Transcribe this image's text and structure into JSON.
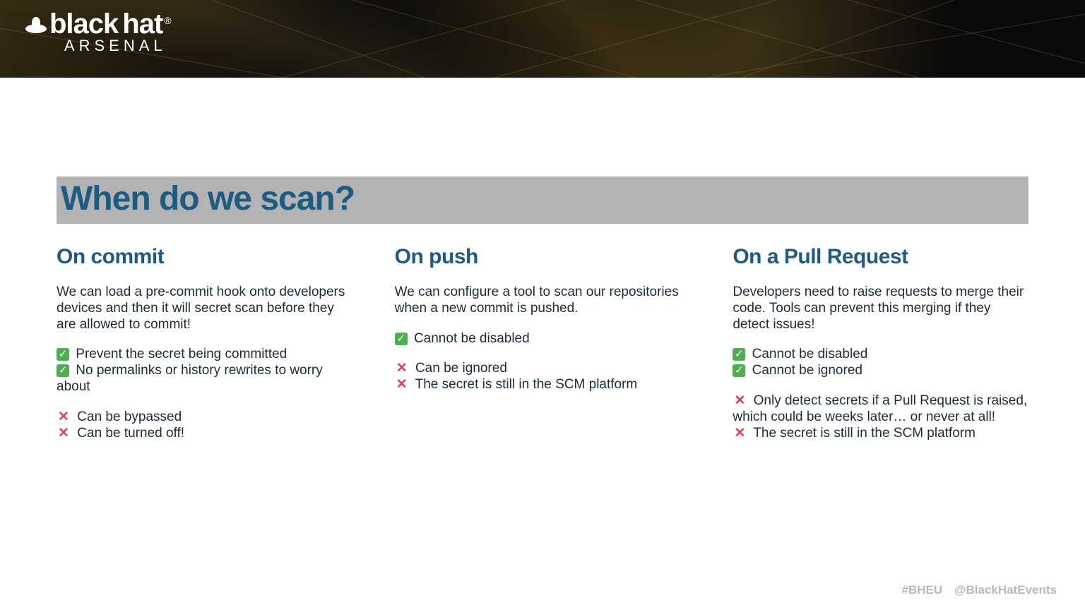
{
  "logo": {
    "brand_a": "black",
    "brand_b": "hat",
    "sub": "ARSENAL"
  },
  "title": "When do we scan?",
  "columns": [
    {
      "heading": "On commit",
      "intro": "We can load a pre-commit hook onto developers devices and then it will secret scan before they are allowed to commit!",
      "pros": [
        "Prevent the secret being committed",
        "No permalinks or history rewrites to worry about"
      ],
      "cons": [
        "Can be bypassed",
        "Can be turned off!"
      ]
    },
    {
      "heading": "On push",
      "intro": "We can configure a tool to scan our repositories when a new commit is pushed.",
      "pros": [
        "Cannot be disabled"
      ],
      "cons": [
        "Can be ignored",
        "The secret is still in the SCM platform"
      ]
    },
    {
      "heading": "On a Pull Request",
      "intro": "Developers need to raise requests to merge their code. Tools can prevent this merging if they detect issues!",
      "pros": [
        "Cannot be disabled",
        "Cannot be ignored"
      ],
      "cons": [
        "Only detect secrets if a Pull Request is raised, which could be weeks later… or never at all!",
        "The secret is still in the SCM platform"
      ]
    }
  ],
  "footer": {
    "hashtag": "#BHEU",
    "handle": "@BlackHatEvents"
  }
}
